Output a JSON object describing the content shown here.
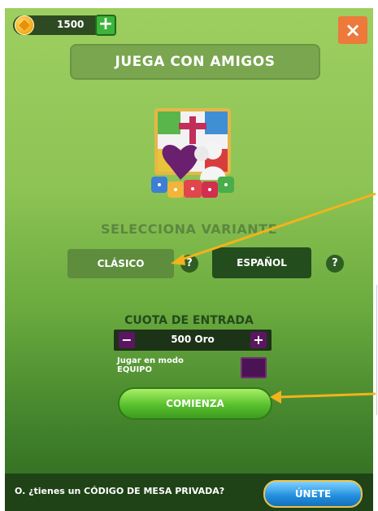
{
  "header": {
    "coins": "1500",
    "coin_plus": "+",
    "close": "×"
  },
  "title": "JUEGA CON AMIGOS",
  "variant": {
    "heading": "SELECCIONA VARIANTE",
    "options": [
      "CLÁSICO",
      "ESPAÑOL"
    ],
    "help": "?"
  },
  "entry": {
    "heading": "CUOTA DE ENTRADA",
    "minus": "−",
    "value": "500 Oro",
    "plus": "+",
    "team_mode": "Jugar en modo EQUIPO"
  },
  "start_label": "COMIENZA",
  "footer": {
    "text": "O. ¿tienes un CÓDIGO DE MESA PRIVADA?",
    "join_label": "ÚNETE"
  },
  "colors": {
    "accent_green": "#58c02d",
    "close_orange": "#ed7a3a",
    "join_blue": "#1f8ddd",
    "annotation_arrow": "#f2b31c"
  }
}
